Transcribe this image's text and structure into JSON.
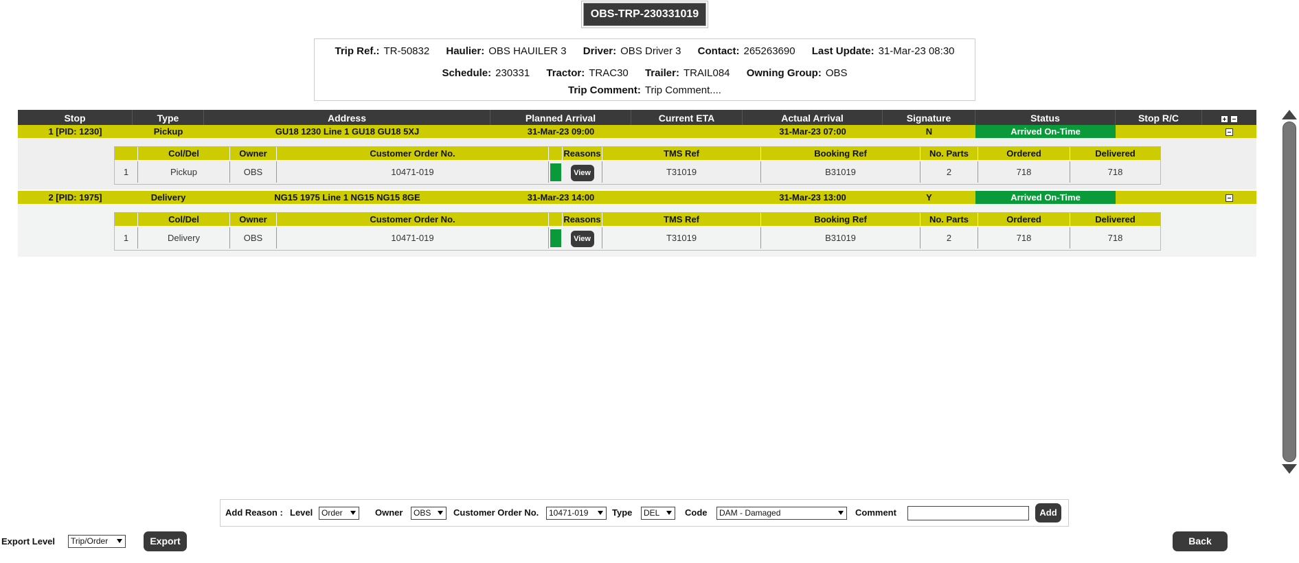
{
  "title": "OBS-TRP-230331019",
  "trip": {
    "row1": [
      {
        "label": "Trip Ref.:",
        "value": "TR-50832"
      },
      {
        "label": "Haulier:",
        "value": "OBS HAUILER 3"
      },
      {
        "label": "Driver:",
        "value": "OBS Driver 3"
      },
      {
        "label": "Contact:",
        "value": "265263690"
      },
      {
        "label": "Last Update:",
        "value": "31-Mar-23 08:30"
      }
    ],
    "row2": [
      {
        "label": "Schedule:",
        "value": "230331"
      },
      {
        "label": "Tractor:",
        "value": "TRAC30"
      },
      {
        "label": "Trailer:",
        "value": "TRAIL084"
      },
      {
        "label": "Owning Group:",
        "value": "OBS"
      }
    ],
    "row3": [
      {
        "label": "Trip Comment:",
        "value": "Trip Comment...."
      }
    ]
  },
  "table": {
    "headers": [
      "Stop",
      "Type",
      "Address",
      "Planned Arrival",
      "Current ETA",
      "Actual Arrival",
      "Signature",
      "Status",
      "Stop R/C"
    ],
    "stops": [
      {
        "stop": "1  [PID: 1230]",
        "type": "Pickup",
        "address": "GU18 1230 Line 1 GU18 GU18 5XJ",
        "planned": "31-Mar-23 09:00",
        "eta": "",
        "actual": "31-Mar-23 07:00",
        "signature": "N",
        "status": "Arrived On-Time",
        "rc": ""
      },
      {
        "stop": "2  [PID: 1975]",
        "type": "Delivery",
        "address": "NG15 1975 Line 1 NG15 NG15 8GE",
        "planned": "31-Mar-23 14:00",
        "eta": "",
        "actual": "31-Mar-23 13:00",
        "signature": "Y",
        "status": "Arrived On-Time",
        "rc": ""
      }
    ],
    "sub_headers": [
      "",
      "Col/Del",
      "Owner",
      "Customer Order No.",
      "",
      "Reasons",
      "TMS Ref",
      "Booking Ref",
      "No. Parts",
      "Ordered",
      "Delivered"
    ],
    "sub_rows": [
      {
        "idx": "1",
        "coldel": "Pickup",
        "owner": "OBS",
        "order": "10471-019",
        "reasons": "View",
        "tms": "T31019",
        "booking": "B31019",
        "parts": "2",
        "ordered": "718",
        "delivered": "718"
      },
      {
        "idx": "1",
        "coldel": "Delivery",
        "owner": "OBS",
        "order": "10471-019",
        "reasons": "View",
        "tms": "T31019",
        "booking": "B31019",
        "parts": "2",
        "ordered": "718",
        "delivered": "718"
      }
    ]
  },
  "reason": {
    "title": "Add Reason :",
    "level_label": "Level",
    "level_value": "Order",
    "owner_label": "Owner",
    "owner_value": "OBS",
    "order_label": "Customer Order No.",
    "order_value": "10471-019",
    "type_label": "Type",
    "type_value": "DEL",
    "code_label": "Code",
    "code_value": "DAM - Damaged",
    "comment_label": "Comment",
    "add_label": "Add"
  },
  "export": {
    "label": "Export Level",
    "value": "Trip/Order",
    "button": "Export"
  },
  "back_label": "Back",
  "colors": {
    "accent": "#cccc00",
    "status_green": "#0a9a3a",
    "dark": "#3a3a3a"
  }
}
